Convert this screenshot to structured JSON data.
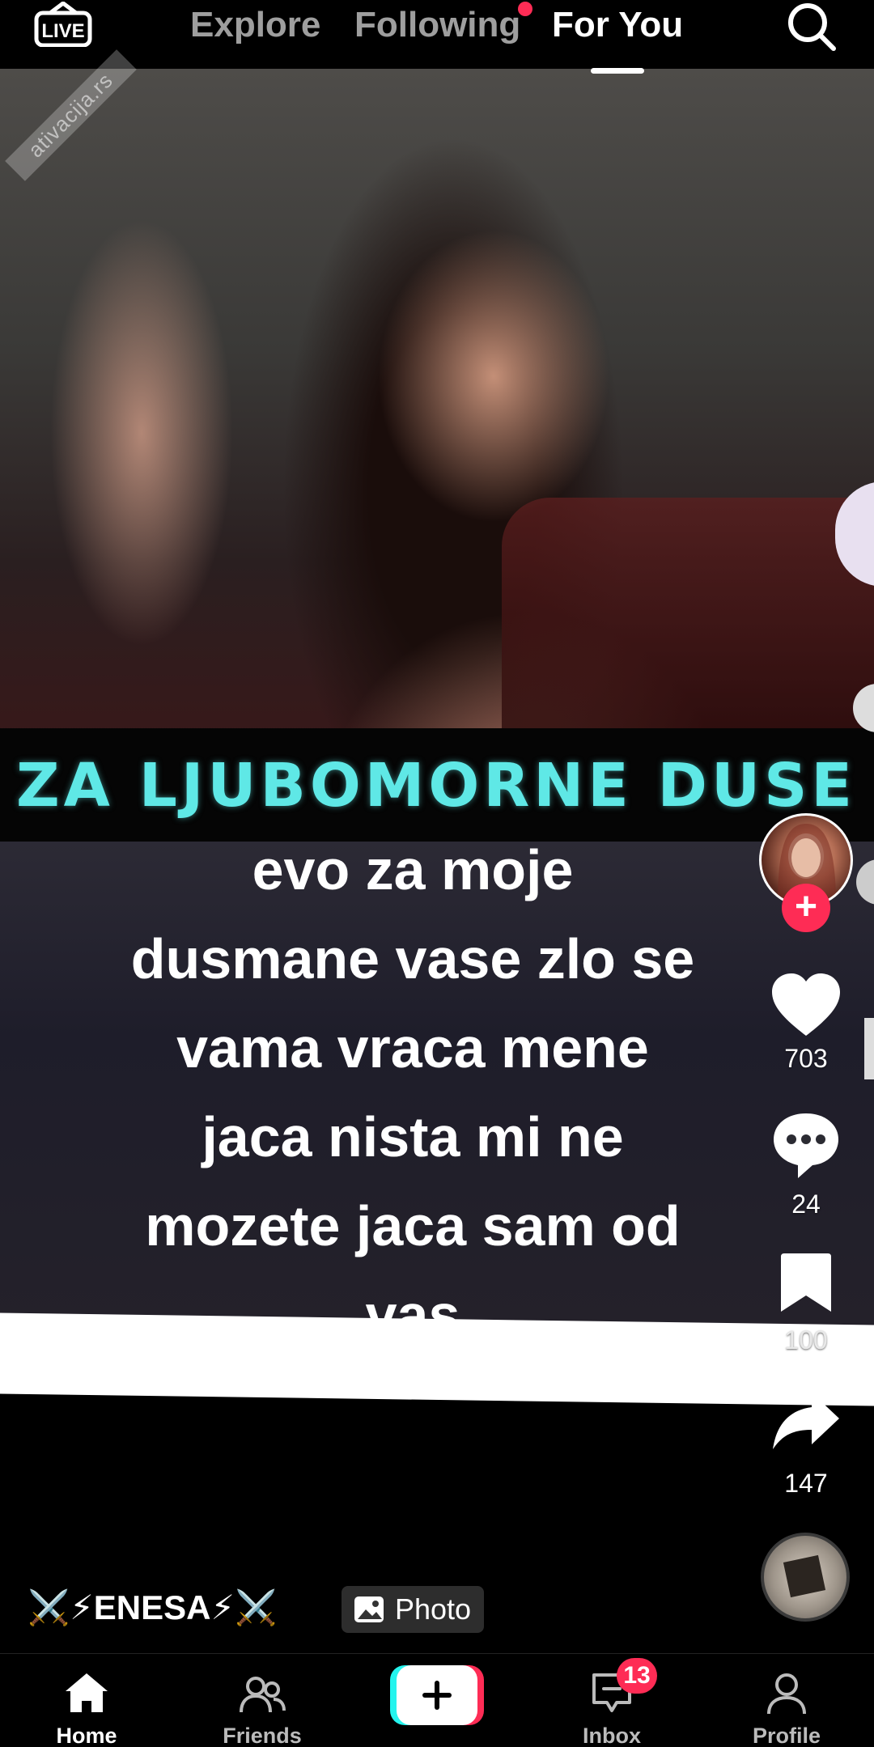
{
  "topnav": {
    "live_label": "LIVE",
    "tabs": [
      {
        "label": "Explore",
        "active": false
      },
      {
        "label": "Following",
        "active": false,
        "has_dot": true
      },
      {
        "label": "For You",
        "active": true
      }
    ],
    "search_icon": "search-icon"
  },
  "post": {
    "watermark": "ativacija.rs",
    "banner_text": "ZA LJUBOMORNE DUSE",
    "caption_lines": [
      "evo za moje",
      "dusmane vase zlo se",
      "vama vraca  mene",
      "jaca nista mi ne",
      "mozete jaca sam  od",
      "vas"
    ],
    "author": "⚔️⚡ENESA⚡⚔️",
    "photo_tag": "Photo"
  },
  "actions": {
    "likes": "703",
    "comments": "24",
    "saves": "100",
    "shares": "147",
    "follow_icon": "plus-icon"
  },
  "bottomnav": {
    "items": [
      {
        "label": "Home",
        "icon": "home-icon",
        "active": true
      },
      {
        "label": "Friends",
        "icon": "friends-icon",
        "active": false
      },
      {
        "label": "",
        "icon": "plus-icon"
      },
      {
        "label": "Inbox",
        "icon": "inbox-icon",
        "active": false,
        "badge": "13"
      },
      {
        "label": "Profile",
        "icon": "profile-icon",
        "active": false
      }
    ]
  },
  "colors": {
    "accent": "#fe2c55",
    "banner_text": "#5fe8e6",
    "create_left": "#25f4ee",
    "create_right": "#fe2c55"
  }
}
